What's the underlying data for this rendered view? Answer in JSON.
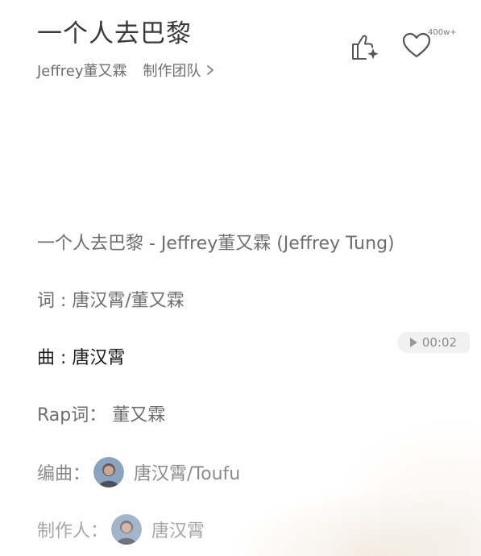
{
  "song": {
    "title": "一个人去巴黎",
    "artist": "Jeffrey董又霖",
    "team_label": "制作团队"
  },
  "actions": {
    "like_icon": "thumbs-up-sparkle-icon",
    "favorite_icon": "heart-icon",
    "favorite_count": "400w+"
  },
  "lyrics": {
    "line1": "一个人去巴黎 - Jeffrey董又霖 (Jeffrey Tung)",
    "line2": "词 : 唐汉霄/董又霖",
    "line3": "曲 : 唐汉霄",
    "line4": "Rap词：  董又霖",
    "line5_label": "编曲：",
    "line5_names": "唐汉霄/Toufu",
    "line6_label": "制作人：",
    "line6_names": "唐汉霄"
  },
  "timestamp": {
    "time": "00:02",
    "icon": "play-icon"
  },
  "colors": {
    "active_line": "#1a1a1a",
    "inactive_line": "#6e6e6e",
    "pill_bg": "#f1f1f1"
  }
}
